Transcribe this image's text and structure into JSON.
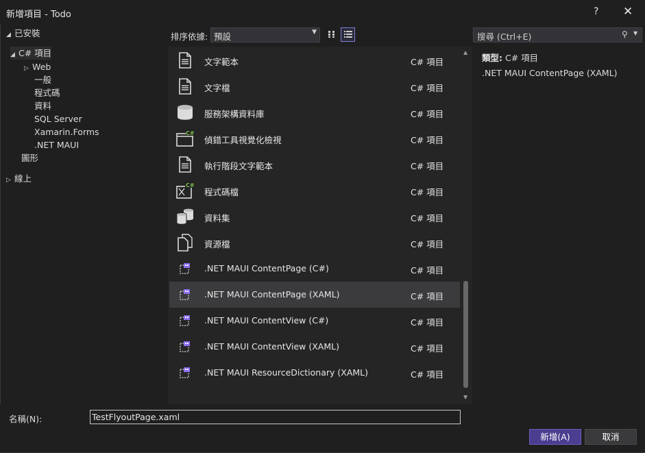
{
  "window": {
    "title": "新增項目 - Todo",
    "help": "?",
    "close": "✕"
  },
  "tree": {
    "installed": "已安裝",
    "csharp": "C# 項目",
    "web": "Web",
    "general": "一般",
    "code": "程式碼",
    "data": "資料",
    "sql": "SQL Server",
    "xamarin": "Xamarin.Forms",
    "maui": ".NET MAUI",
    "graphics": "圖形",
    "online": "線上"
  },
  "sort": {
    "label": "排序依據:",
    "value": "預設"
  },
  "templates": [
    {
      "name": "文字範本",
      "type": "C# 項目",
      "icon": "document-icon"
    },
    {
      "name": "文字檔",
      "type": "C# 項目",
      "icon": "document-icon"
    },
    {
      "name": "服務架構資料庫",
      "type": "C# 項目",
      "icon": "database-icon"
    },
    {
      "name": "偵錯工具視覺化檢視",
      "type": "C# 項目",
      "icon": "window-csharp-icon"
    },
    {
      "name": "執行階段文字範本",
      "type": "C# 項目",
      "icon": "document-icon"
    },
    {
      "name": "程式碼檔",
      "type": "C# 項目",
      "icon": "code-file-icon"
    },
    {
      "name": "資料集",
      "type": "C# 項目",
      "icon": "dataset-icon"
    },
    {
      "name": "資源檔",
      "type": "C# 項目",
      "icon": "resource-file-icon"
    },
    {
      "name": ".NET MAUI ContentPage (C#)",
      "type": "C# 項目",
      "icon": "maui-icon"
    },
    {
      "name": ".NET MAUI ContentPage (XAML)",
      "type": "C# 項目",
      "icon": "maui-icon"
    },
    {
      "name": ".NET MAUI ContentView (C#)",
      "type": "C# 項目",
      "icon": "maui-icon"
    },
    {
      "name": ".NET MAUI ContentView (XAML)",
      "type": "C# 項目",
      "icon": "maui-icon"
    },
    {
      "name": ".NET MAUI ResourceDictionary (XAML)",
      "type": "C# 項目",
      "icon": "maui-icon"
    }
  ],
  "selected_index": 9,
  "search": {
    "placeholder": "搜尋 (Ctrl+E)"
  },
  "details": {
    "type_label": "類型:",
    "type_value": "C# 項目",
    "description": ".NET MAUI ContentPage (XAML)"
  },
  "name_field": {
    "label": "名稱(N):",
    "value": "TestFlyoutPage.xaml"
  },
  "buttons": {
    "add": "新增(A)",
    "cancel": "取消"
  },
  "colors": {
    "accent": "#4b3d8f",
    "icon_green": "#7bbf4f",
    "icon_purple": "#8b6cf0"
  }
}
